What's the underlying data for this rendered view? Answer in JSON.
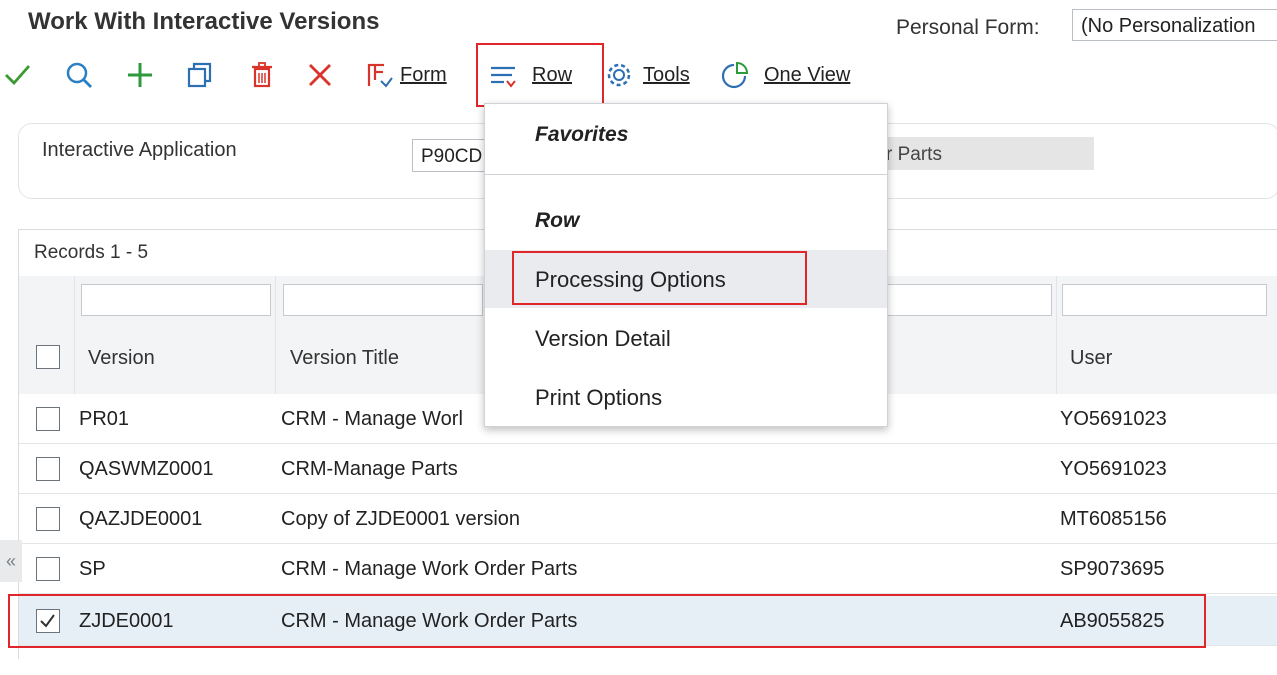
{
  "header": {
    "title": "Work With Interactive Versions",
    "personal_form_label": "Personal Form:",
    "personal_form_value": "(No Personalization"
  },
  "toolbar": {
    "form_label": "Form",
    "row_label": "Row",
    "tools_label": "Tools",
    "one_view_label": "One View"
  },
  "filter": {
    "label": "Interactive Application",
    "value": "P90CD",
    "description": "r Parts"
  },
  "grid": {
    "records_label": "Records 1 - 5",
    "columns": {
      "version": "Version",
      "title": "Version Title",
      "user": "User"
    },
    "rows": [
      {
        "version": "PR01",
        "title": "CRM - Manage Worl",
        "user": "YO5691023",
        "checked": false
      },
      {
        "version": "QASWMZ0001",
        "title": "CRM-Manage Parts",
        "user": "YO5691023",
        "checked": false
      },
      {
        "version": "QAZJDE0001",
        "title": "Copy of ZJDE0001 version",
        "user": "MT6085156",
        "checked": false
      },
      {
        "version": "SP",
        "title": "CRM - Manage Work Order Parts",
        "user": "SP9073695",
        "checked": false
      },
      {
        "version": "ZJDE0001",
        "title": "CRM - Manage Work Order Parts",
        "user": "AB9055825",
        "checked": true
      }
    ]
  },
  "row_menu": {
    "favorites_label": "Favorites",
    "row_label": "Row",
    "items": [
      "Processing Options",
      "Version Detail",
      "Print Options"
    ],
    "highlighted_item": "Processing Options"
  },
  "collapse_glyph": "«",
  "colors": {
    "check_green": "#3a9a2f",
    "search_blue": "#2a7fc4",
    "add_green": "#2e9a3c",
    "delete_red": "#d9342b",
    "icon_blue": "#2d6fb3",
    "highlight_red": "#e0262b"
  }
}
